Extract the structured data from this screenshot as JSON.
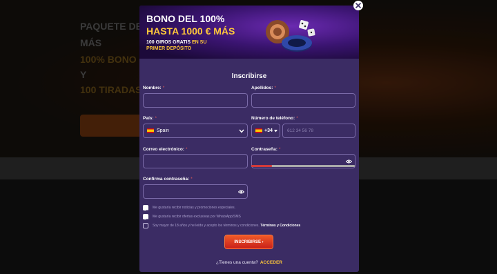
{
  "background": {
    "hero_lines": [
      "PAQUETE DE",
      "MÁS",
      "100% BONO",
      "Y",
      "100 TIRADAS"
    ]
  },
  "modal": {
    "banner": {
      "line1": "BONO DEL 100%",
      "line2": "HASTA 1000 € MÁS",
      "line3_white": "100 GIROS GRATIS",
      "line3_yellow": "EN SU",
      "line4": "PRIMER DEPÓSITO"
    },
    "title": "Inscribirse",
    "fields": {
      "first_name": {
        "label": "Nombre:",
        "value": ""
      },
      "last_name": {
        "label": "Apellidos:",
        "value": ""
      },
      "country": {
        "label": "País:",
        "value": "Spain"
      },
      "phone": {
        "label": "Número de teléfono:",
        "prefix": "+34",
        "placeholder": "612 34 56 78"
      },
      "email": {
        "label": "Correo electrónico:",
        "value": ""
      },
      "password": {
        "label": "Contraseña:",
        "strength": 0.2
      },
      "confirm_password": {
        "label": "Confirma contraseña:"
      }
    },
    "required_marker": "*",
    "checkboxes": [
      {
        "text": "Me gustaría recibir noticias y promociones especiales.",
        "checked": true
      },
      {
        "text": "Me gustaría recibir ofertas exclusivas por WhatsApp/SMS",
        "checked": true
      },
      {
        "text": "Soy mayor de 18 años y he leído y acepto los términos y condiciones.",
        "link": "Términos y Condiciones",
        "checked": false
      }
    ],
    "submit_label": "INSCRIBIRSE",
    "footer_text": "¿Tienes una cuenta?",
    "footer_link": "ACCEDER"
  },
  "colors": {
    "modal_bg": "#3b2c64",
    "accent_yellow": "#ffc83a",
    "submit_red": "#e0321e",
    "strength_red": "#d23a3a"
  },
  "icons": {
    "close": "close-icon",
    "country_flag": "spain-flag-icon",
    "dropdown": "chevron-down-icon",
    "password_toggle": "eye-icon"
  }
}
